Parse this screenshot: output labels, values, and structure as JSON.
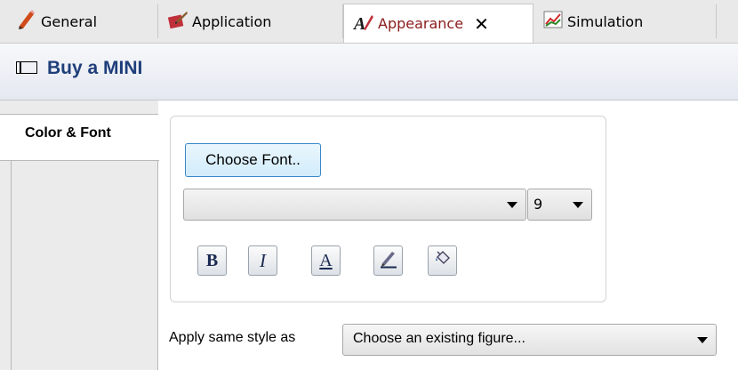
{
  "tabs": [
    {
      "label": "General",
      "icon": "pencil-icon"
    },
    {
      "label": "Application",
      "icon": "application-icon"
    },
    {
      "label": "Appearance",
      "icon": "appearance-icon",
      "active": true
    },
    {
      "label": "Simulation",
      "icon": "simulation-chart-icon"
    }
  ],
  "close_glyph": "✕",
  "title": "Buy a MINI",
  "side_tabs": [
    {
      "label": "Color & Font"
    }
  ],
  "font_section": {
    "choose_font_label": "Choose Font..",
    "font_name_value": "",
    "font_size_value": "9",
    "style_buttons": [
      {
        "label": "B",
        "icon": "bold-icon"
      },
      {
        "label": "I",
        "icon": "italic-icon"
      },
      {
        "label": "A",
        "icon": "font-color-icon"
      },
      {
        "label": "",
        "icon": "line-color-icon"
      },
      {
        "label": "",
        "icon": "fill-color-icon"
      }
    ]
  },
  "apply_style": {
    "label": "Apply same style as",
    "value": "Choose an existing figure..."
  },
  "colors": {
    "title": "#1e3e7a",
    "active_tab_text": "#8a1c1c",
    "button_focus_border": "#3a88c8"
  }
}
